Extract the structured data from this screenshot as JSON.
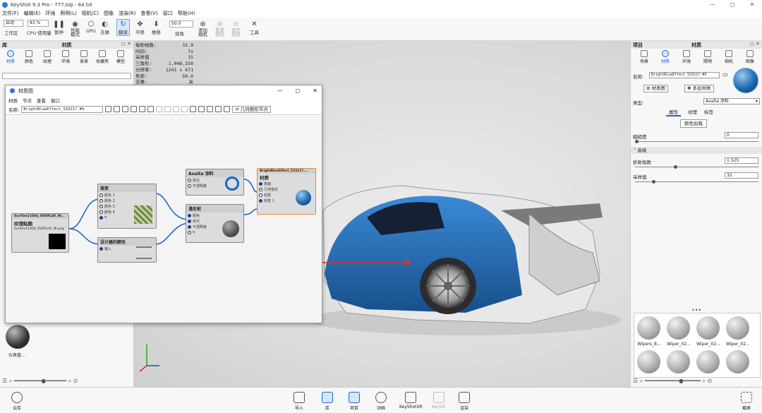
{
  "app": {
    "title": "KeyShot 9.3 Pro  -  777.bip  -  64 bit",
    "window_controls": [
      "—",
      "◻",
      "✕"
    ]
  },
  "menu": [
    "文件(F)",
    "编辑(E)",
    "环境",
    "照明(L)",
    "相机(C)",
    "图像",
    "渲染(R)",
    "查看(V)",
    "窗口",
    "帮助(H)"
  ],
  "toolbar": {
    "workspace_select": "启动",
    "zoom_select": "83 %",
    "fov_value": "50.0",
    "items": {
      "workspace": "工作区",
      "cpu": "CPU 使用量",
      "pause": "暂停",
      "perf": "性能\n模式",
      "gpu": "GPU",
      "denoise": "去噪",
      "tumble": "翻滚",
      "pan": "平移",
      "dolly": "推移",
      "view": "视角",
      "add_camera": "添加\n相机",
      "reset_camera": "重置\n相机",
      "lock_camera": "锁定\n相机",
      "tools": "工具"
    }
  },
  "library": {
    "panel_title": "材质",
    "header": "库",
    "tabs": [
      "材质",
      "颜色",
      "纹理",
      "环境",
      "背景",
      "收藏夹",
      "模型"
    ],
    "thumb_label": "仪表盘..."
  },
  "hud": [
    [
      "每秒帧数:",
      "31.9"
    ],
    [
      "时间:",
      "7s"
    ],
    [
      "采样值",
      "15"
    ],
    [
      "三角形:",
      "1,048,330"
    ],
    [
      "分辨率:",
      "1241 x 671"
    ],
    [
      "焦距:",
      "50.0"
    ],
    [
      "去噪:",
      "关"
    ]
  ],
  "material_graph": {
    "title": "材质图",
    "menu": [
      "材质",
      "节点",
      "查看",
      "窗口"
    ],
    "name_label": "名称:",
    "name_value": "BrightBlueEffect_53311? #9",
    "geom_button": "几何图形节点",
    "nodes": {
      "texture": {
        "title": "SurfSm11004_OVERLAY_NI...",
        "name": "纹理贴图",
        "file": "SurfSm11004_OVERLAY_NI.png"
      },
      "blend": {
        "title": "渐变",
        "ports": [
          "颜色 1",
          "颜色 2",
          "颜色 3",
          "颜色 4",
          "α"
        ]
      },
      "paint": {
        "title": "Axalta 涂料",
        "ports": [
          "高光",
          "不透明度"
        ]
      },
      "diffuse": {
        "title": "漫反射",
        "ports": [
          "颜色",
          "高光",
          "不透明度",
          "α"
        ]
      },
      "colormap": {
        "title": "设计器的颜色",
        "ports": [
          "输入"
        ]
      },
      "output": {
        "title": "BrightBlueEffect_53311?...",
        "name": "材质",
        "ports": [
          "表面",
          "几何变形",
          "标签",
          "标签 1"
        ]
      }
    }
  },
  "project": {
    "panel_title": "材质",
    "header": "项目",
    "tabs": [
      "场景",
      "材质",
      "环境",
      "照明",
      "相机",
      "图像"
    ],
    "name_label": "名称:",
    "name_value": "BrightBlueEffect_53311? #9",
    "graph_button": "材质图",
    "multilayer_button": "多层材质",
    "type_label": "类型:",
    "type_value": "Axalta 涂料",
    "subtabs": [
      "属性",
      "纹理",
      "标签"
    ],
    "color_button": "颜色加载",
    "roughness_label": "粗糙度",
    "roughness_value": "0",
    "advanced": "高级",
    "ior_label": "折射指数",
    "ior_value": "1.525",
    "samples_label": "采样值",
    "samples_value": "32",
    "swatches": [
      "Wipers_B...",
      "Wiper_02...",
      "Wiper_02...",
      "Wiper_02..."
    ]
  },
  "bottombar": {
    "cloud": "云库",
    "items": [
      "导入",
      "库",
      "项目",
      "动画",
      "KeyShotXR",
      "KeyVR",
      "渲染"
    ],
    "right": "截屏"
  },
  "colors": {
    "accent": "#1a64c8",
    "car_blue": "#1f6bb4"
  }
}
